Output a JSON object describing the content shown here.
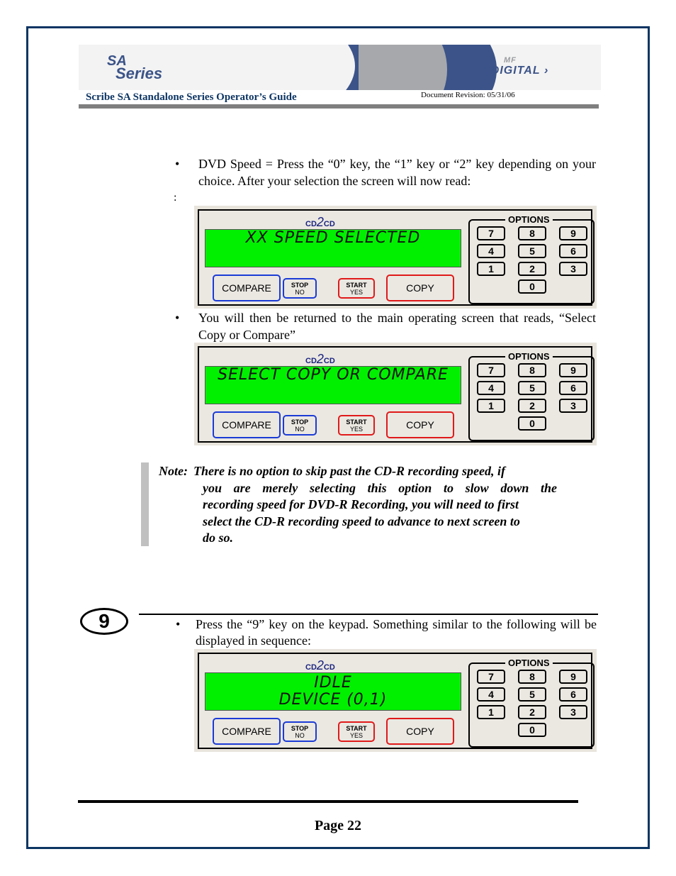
{
  "header": {
    "left_logo": {
      "line1": "SA",
      "line2": "Series"
    },
    "right_logo": {
      "small": "MF",
      "main": "DIGITAL"
    },
    "title": "Scribe SA Standalone Series Operator’s Guide",
    "revision": "Document Revision: 05/31/06"
  },
  "content": {
    "bullet1": {
      "symbol": "•",
      "text": "DVD Speed = Press the “0” key, the “1” key or “2” key depending on your choice. After your selection the screen will now read:"
    },
    "stray_colon": ":",
    "bullet2": {
      "symbol": "•",
      "text": "You will then be returned to the main operating screen that reads, “Select Copy or Compare”"
    },
    "note": {
      "label": "Note:",
      "lines": [
        "There is no option to skip past the CD-R recording speed, if",
        "you are merely selecting this option to slow down the",
        "recording speed for DVD-R Recording, you will need to first",
        "select the CD-R recording speed to advance to next screen to",
        "do so."
      ]
    },
    "step": {
      "number": "9"
    },
    "bullet3": {
      "symbol": "•",
      "text": "Press the “9” key on the keypad. Something similar to the following will be displayed in sequence:"
    }
  },
  "panel_common": {
    "brand_left": "CD",
    "brand_two": "2",
    "brand_right": "CD",
    "compare_label": "COMPARE",
    "stop_top": "STOP",
    "stop_bottom": "NO",
    "start_top": "START",
    "start_bottom": "YES",
    "copy_label": "COPY",
    "options_label": "OPTIONS",
    "keys": [
      "7",
      "8",
      "9",
      "4",
      "5",
      "6",
      "1",
      "2",
      "3",
      "0"
    ],
    "lcd_color": "#00f000",
    "blue_border": "#1b3bd6",
    "red_border": "#e01a1a"
  },
  "panels": [
    {
      "lcd_lines": [
        "XX SPEED SELECTED"
      ]
    },
    {
      "lcd_lines": [
        "SELECT COPY OR COMPARE"
      ]
    },
    {
      "lcd_lines": [
        "IDLE",
        "DEVICE (0,1)"
      ]
    }
  ],
  "footer": {
    "page": "Page 22"
  },
  "colors": {
    "frame": "#0d3563",
    "banner_blue": "#3b5388",
    "note_bar": "#c0c0c0"
  }
}
